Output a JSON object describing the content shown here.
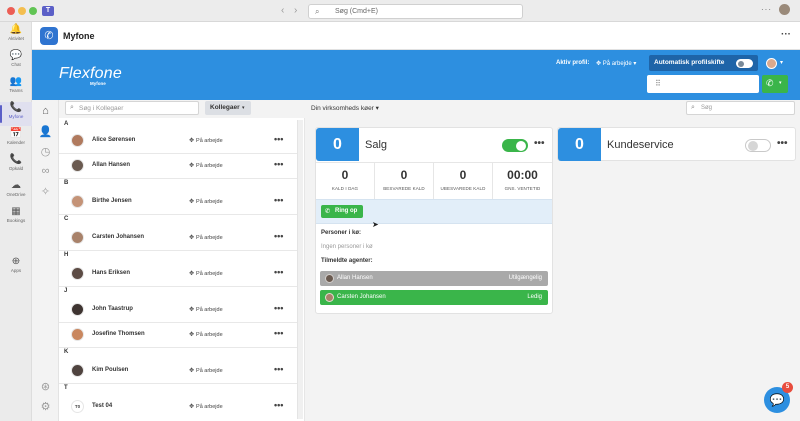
{
  "window": {
    "search_placeholder": "Søg (Cmd+E)",
    "nav_back": "‹",
    "nav_forward": "›",
    "more": "···"
  },
  "teams_rail": {
    "items": [
      {
        "label": "Aktivitet",
        "icon": "🔔"
      },
      {
        "label": "Chat",
        "icon": "💬"
      },
      {
        "label": "Teams",
        "icon": "👥"
      },
      {
        "label": "Myfone",
        "icon": "📞"
      },
      {
        "label": "Kalender",
        "icon": "📅"
      },
      {
        "label": "Opkald",
        "icon": "📞"
      },
      {
        "label": "OneDrive",
        "icon": "☁"
      },
      {
        "label": "Bookings",
        "icon": "▦"
      },
      {
        "label": "Apps",
        "icon": "⊕"
      }
    ],
    "overflow": "···"
  },
  "app": {
    "title": "Myfone",
    "more": "···"
  },
  "banner": {
    "logo": "Flexfone",
    "logo_sub": "Myfone",
    "profile_label": "Aktiv profil:",
    "profile_value": "På arbejde",
    "auto_label": "Automatisk profilskifte",
    "auto_on": false
  },
  "colleagues": {
    "search_placeholder": "Søg i Kollegaer",
    "filter_label": "Kollegaer",
    "groups": [
      {
        "letter": "A",
        "people": [
          {
            "name": "Alice Sørensen",
            "status": "På arbejde",
            "avatar": "#b07a5e"
          },
          {
            "name": "Allan Hansen",
            "status": "På arbejde",
            "avatar": "#6a5a50"
          }
        ]
      },
      {
        "letter": "B",
        "people": [
          {
            "name": "Birthe Jensen",
            "status": "På arbejde",
            "avatar": "#c49377"
          }
        ]
      },
      {
        "letter": "C",
        "people": [
          {
            "name": "Carsten Johansen",
            "status": "På arbejde",
            "avatar": "#a8826a"
          }
        ]
      },
      {
        "letter": "H",
        "people": [
          {
            "name": "Hans Eriksen",
            "status": "På arbejde",
            "avatar": "#5c4b44"
          }
        ]
      },
      {
        "letter": "J",
        "people": [
          {
            "name": "John Taastrup",
            "status": "På arbejde",
            "avatar": "#3e3431"
          },
          {
            "name": "Josefine Thomsen",
            "status": "På arbejde",
            "avatar": "#c9875f"
          }
        ]
      },
      {
        "letter": "K",
        "people": [
          {
            "name": "Kim Poulsen",
            "status": "På arbejde",
            "avatar": "#4f433f"
          }
        ]
      },
      {
        "letter": "T",
        "people": [
          {
            "name": "Test 04",
            "status": "På arbejde",
            "initials": "T0"
          }
        ]
      }
    ]
  },
  "queues": {
    "selector": "Din virksomheds køer",
    "search_placeholder": "Søg",
    "list": [
      {
        "count": "0",
        "name": "Salg",
        "enabled": true,
        "stats": [
          {
            "value": "0",
            "label": "KALD I DAG"
          },
          {
            "value": "0",
            "label": "BESVAREDE KALD"
          },
          {
            "value": "0",
            "label": "UBESVAREDE KALD"
          },
          {
            "value": "00:00",
            "label": "GNS. VENTETID"
          }
        ],
        "ring_label": "Ring op",
        "queue_people_label": "Personer i kø:",
        "queue_people_empty": "Ingen personer i kø",
        "agents_label": "Tilmeldte agenter:",
        "agents": [
          {
            "name": "Allan Hansen",
            "status": "Utilgængelig"
          },
          {
            "name": "Carsten Johansen",
            "status": "Ledig"
          }
        ]
      },
      {
        "count": "0",
        "name": "Kundeservice",
        "enabled": false
      }
    ]
  },
  "chat": {
    "badge": "5"
  },
  "colors": {
    "brand_blue": "#2d8fe0",
    "green": "#3ab54a",
    "teams_purple": "#5b5fc7",
    "unavailable_grey": "#a9a9a9"
  }
}
